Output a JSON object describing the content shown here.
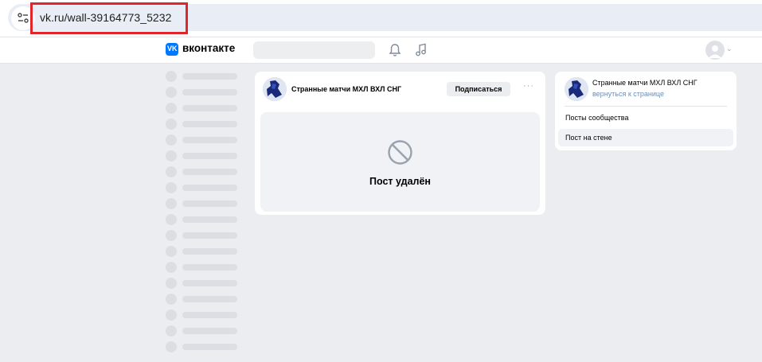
{
  "browser": {
    "url": "vk.ru/wall-39164773_5232",
    "highlight_color": "#e0262b"
  },
  "header": {
    "logo_mark": "VK",
    "brand": "вконтакте",
    "icons": [
      "bell-icon",
      "music-icon",
      "avatar-icon",
      "chevron-down-icon"
    ],
    "accent": "#0077ff"
  },
  "post": {
    "group_name": "Странные матчи МХЛ ВХЛ СНГ",
    "subscribe_label": "Подписаться",
    "more_label": "···",
    "deleted_text": "Пост удалён"
  },
  "sidebar_right": {
    "group_name": "Странные матчи МХЛ ВХЛ СНГ",
    "back_link": "вернуться к странице",
    "items": [
      {
        "label": "Посты сообщества",
        "active": false
      },
      {
        "label": "Пост на стене",
        "active": true
      }
    ]
  }
}
